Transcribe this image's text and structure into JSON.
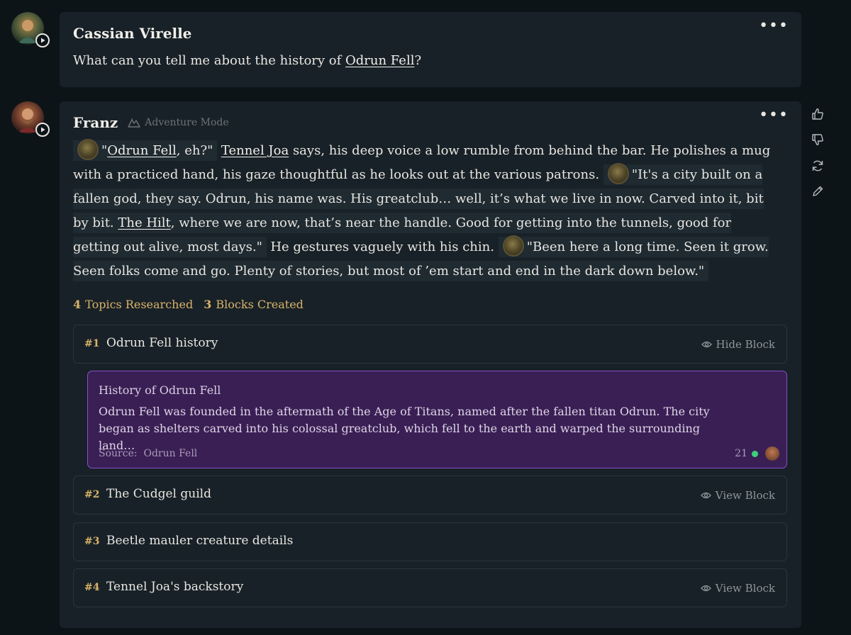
{
  "messages": {
    "user": {
      "name": "Cassian Virelle",
      "text_before": "What can you tell me about the history of ",
      "link": "Odrun Fell",
      "text_after": "?"
    },
    "assistant": {
      "name": "Franz",
      "mode": "Adventure Mode",
      "story": {
        "p1_link": "Odrun Fell",
        "p1_rest": ", eh?\"",
        "p1_quote_open": "\"",
        "speaker_link": "Tennel Joa",
        "p2": " says, his deep voice a low rumble from behind the bar. He polishes a mug with a practiced hand, his gaze thoughtful as he looks out at the various patrons.",
        "p3_a": "\"It's a city built on a fallen god, they say. Odrun, his name was. His greatclub… well, it’s what we live in now. Carved into it, bit by bit. ",
        "p3_link": "The Hilt",
        "p3_b": ", where we are now, that’s near the handle. Good for getting into the tunnels, good for getting out alive, most days.\"",
        "p4": " He gestures vaguely with his chin.",
        "p5": "\"Been here a long time. Seen it grow. Seen folks come and go. Plenty of stories, but most of ’em start and end in the dark down below.\""
      },
      "stats": {
        "topics_count": "4",
        "topics_label": "Topics Researched",
        "blocks_count": "3",
        "blocks_label": "Blocks Created"
      },
      "blocks": [
        {
          "num": "#1",
          "title": "Odrun Fell history",
          "action": "Hide Block"
        },
        {
          "num": "#2",
          "title": "The Cudgel guild",
          "action": "View Block"
        },
        {
          "num": "#3",
          "title": "Beetle mauler creature details",
          "action": ""
        },
        {
          "num": "#4",
          "title": "Tennel Joa's backstory",
          "action": "View Block"
        }
      ],
      "expanded_block": {
        "title": "History of Odrun Fell",
        "body": "Odrun Fell was founded in the aftermath of the Age of Titans, named after the fallen titan Odrun. The city began as shelters carved into his colossal greatclub, which fell to the earth and warped the surrounding land…",
        "source_label": "Source:",
        "source_value": "Odrun Fell",
        "count": "21"
      }
    }
  },
  "icons": [
    "play-icon",
    "more-icon",
    "adventure-mode-icon",
    "eye-icon",
    "thumbs-up-icon",
    "thumbs-down-icon",
    "regenerate-icon",
    "edit-icon"
  ],
  "colors": {
    "background": "#0d1418",
    "card": "#182127",
    "accent_gold": "#d9b36a",
    "expanded_bg": "#3a1f55",
    "expanded_border": "#8a4fc8",
    "status_green": "#3ccf7a"
  }
}
